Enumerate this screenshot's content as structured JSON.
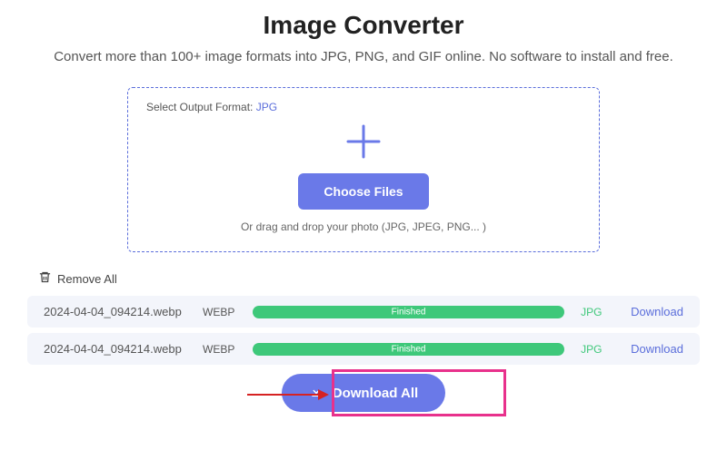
{
  "title": "Image Converter",
  "subtitle": "Convert more than 100+ image formats into JPG, PNG, and GIF online. No software to install and free.",
  "dropzone": {
    "format_label": "Select Output Format:",
    "format_value": "JPG",
    "choose_label": "Choose Files",
    "hint": "Or drag and drop your photo (JPG, JPEG, PNG... )"
  },
  "remove_all_label": "Remove All",
  "files": [
    {
      "name": "2024-04-04_094214.webp",
      "in_ext": "WEBP",
      "status": "Finished",
      "out_ext": "JPG",
      "download": "Download"
    },
    {
      "name": "2024-04-04_094214.webp",
      "in_ext": "WEBP",
      "status": "Finished",
      "out_ext": "JPG",
      "download": "Download"
    }
  ],
  "download_all_label": "Download All"
}
